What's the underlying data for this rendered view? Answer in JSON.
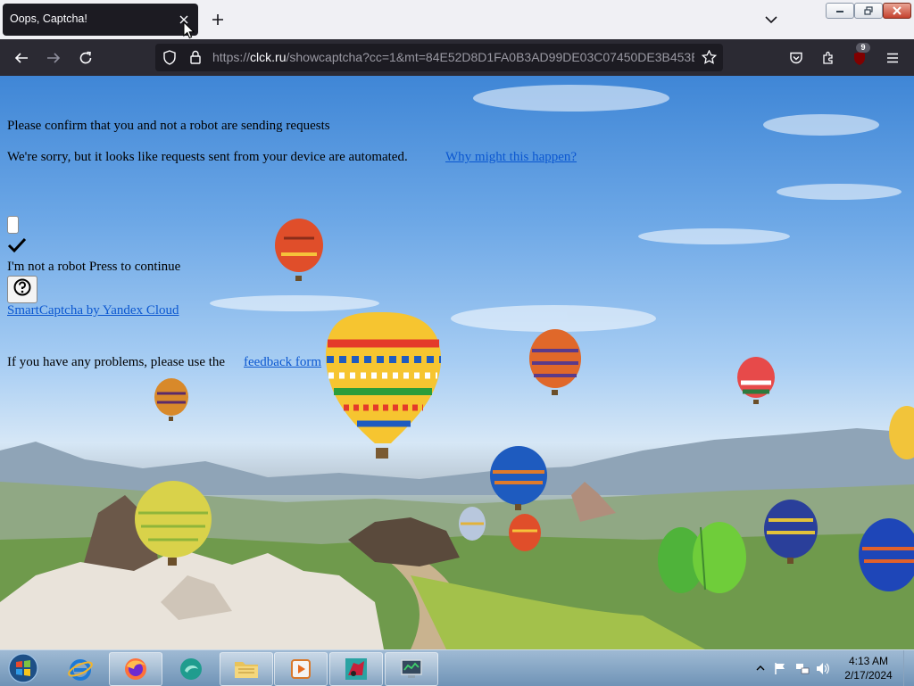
{
  "browser": {
    "tab_title": "Oops, Captcha!",
    "url_prefix": "https://",
    "url_host": "clck.ru",
    "url_rest": "/showcaptcha?cc=1&mt=84E52D8D1FA0B3AD99DE03C07450DE3B453E",
    "extension_badge": "9"
  },
  "page": {
    "heading": "Please confirm that you and not a robot are sending requests",
    "sorry_text": "We're sorry, but it looks like requests sent from your device are automated.",
    "why_link": "Why might this happen?",
    "not_robot_text": "I'm not a robot Press to continue",
    "smartcaptcha_link": "SmartCaptcha by Yandex Cloud",
    "problems_text": "If you have any problems, please use the",
    "feedback_link": "feedback form"
  },
  "taskbar": {
    "time": "4:13 AM",
    "date": "2/17/2024",
    "apps": [
      "internet-explorer",
      "firefox",
      "browser-app",
      "file-explorer",
      "media-player",
      "game-app",
      "network-app"
    ]
  },
  "colors": {
    "link": "#0b57d0",
    "chrome_dark": "#2b2a33",
    "tab_active": "#1c1b22"
  }
}
